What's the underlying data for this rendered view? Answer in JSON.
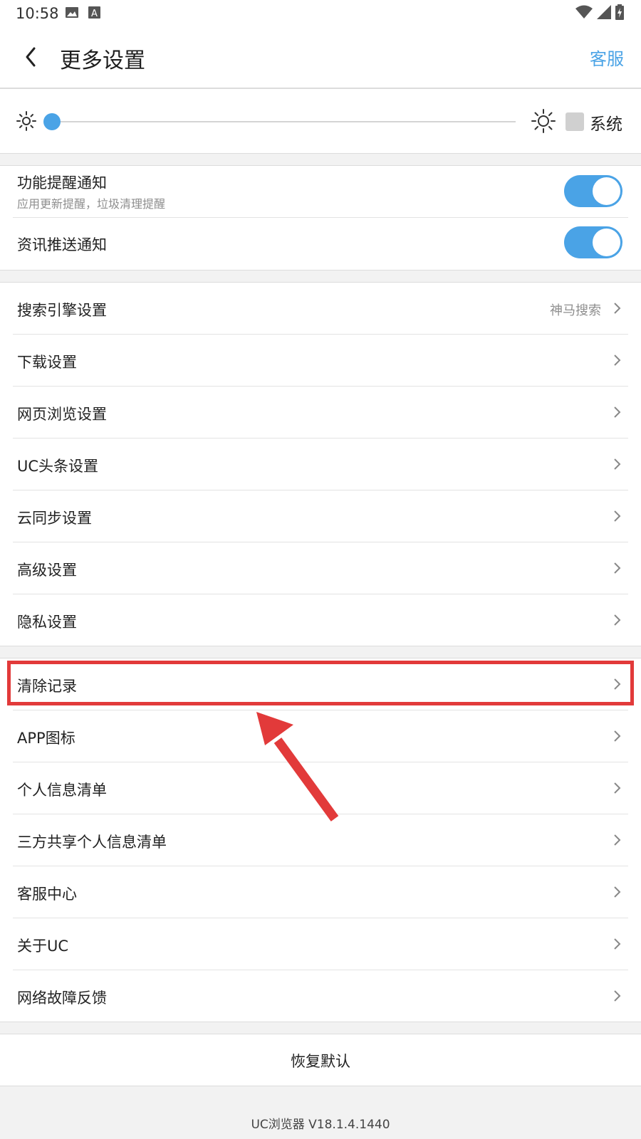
{
  "status_bar": {
    "time": "10:58",
    "icons": [
      "image-icon",
      "font-a-icon",
      "wifi-icon",
      "signal-icon",
      "battery-icon"
    ]
  },
  "header": {
    "title": "更多设置",
    "right_link": "客服"
  },
  "brightness": {
    "level": 0.0,
    "system_label": "系统",
    "system_checked": false
  },
  "notifications": [
    {
      "title": "功能提醒通知",
      "subtitle": "应用更新提醒，垃圾清理提醒",
      "enabled": true
    },
    {
      "title": "资讯推送通知",
      "subtitle": "",
      "enabled": true
    }
  ],
  "settings_group_1": [
    {
      "label": "搜索引擎设置",
      "value": "神马搜索"
    },
    {
      "label": "下载设置",
      "value": ""
    },
    {
      "label": "网页浏览设置",
      "value": ""
    },
    {
      "label": "UC头条设置",
      "value": ""
    },
    {
      "label": "云同步设置",
      "value": ""
    },
    {
      "label": "高级设置",
      "value": ""
    },
    {
      "label": "隐私设置",
      "value": ""
    }
  ],
  "settings_group_2": [
    {
      "label": "清除记录",
      "value": "",
      "highlighted": true
    },
    {
      "label": "APP图标",
      "value": ""
    },
    {
      "label": "个人信息清单",
      "value": ""
    },
    {
      "label": "三方共享个人信息清单",
      "value": ""
    },
    {
      "label": "客服中心",
      "value": ""
    },
    {
      "label": "关于UC",
      "value": ""
    },
    {
      "label": "网络故障反馈",
      "value": ""
    }
  ],
  "restore_default": "恢复默认",
  "version": "UC浏览器 V18.1.4.1440",
  "colors": {
    "accent": "#4aa3e6",
    "annotation": "#e23a3a",
    "background": "#f2f2f2"
  }
}
